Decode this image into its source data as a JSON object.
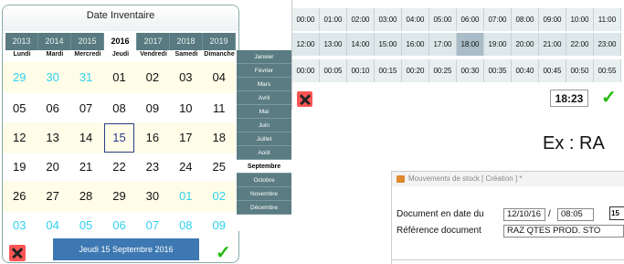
{
  "calendar": {
    "title": "Date Inventaire",
    "years": [
      "2013",
      "2014",
      "2015",
      "2016",
      "2017",
      "2018",
      "2019"
    ],
    "selected_year": "2016",
    "day_names": [
      "Lundi",
      "Mardi",
      "Mercredi",
      "Jeudi",
      "Vendredi",
      "Samedi",
      "Dimanche"
    ],
    "weeks": [
      [
        "29",
        "30",
        "31",
        "01",
        "02",
        "03",
        "04"
      ],
      [
        "05",
        "06",
        "07",
        "08",
        "09",
        "10",
        "11"
      ],
      [
        "12",
        "13",
        "14",
        "15",
        "16",
        "17",
        "18"
      ],
      [
        "19",
        "20",
        "21",
        "22",
        "23",
        "24",
        "25"
      ],
      [
        "26",
        "27",
        "28",
        "29",
        "30",
        "01",
        "02"
      ],
      [
        "03",
        "04",
        "05",
        "06",
        "07",
        "08",
        "09"
      ]
    ],
    "selected_day": "15",
    "months": [
      "Janvier",
      "Février",
      "Mars",
      "Avril",
      "Mai",
      "Juin",
      "Juillet",
      "Août",
      "Septembre",
      "Octobre",
      "Novembre",
      "Décembre"
    ],
    "selected_month": "Septembre",
    "selected_date_label": "Jeudi 15 Septembre 2016"
  },
  "time_picker": {
    "hours_row1": [
      "00:00",
      "01:00",
      "02:00",
      "03:00",
      "04:00",
      "05:00",
      "06:00",
      "07:00",
      "08:00",
      "09:00",
      "10:00",
      "11:00"
    ],
    "hours_row2": [
      "12:00",
      "13:00",
      "14:00",
      "15:00",
      "16:00",
      "17:00",
      "18:00",
      "19:00",
      "20:00",
      "21:00",
      "22:00",
      "23:00"
    ],
    "minutes": [
      "00:00",
      "00:05",
      "00:10",
      "00:15",
      "00:20",
      "00:25",
      "00:30",
      "00:35",
      "00:40",
      "00:45",
      "00:50",
      "00:55"
    ],
    "selected_hour": "18:00",
    "time_value": "18:23"
  },
  "example_text": "Ex : RA",
  "stock_window": {
    "title": "Mouvements de stock  [ Création ] *",
    "doc_date_label": "Document en date du",
    "doc_date": "12/10/16",
    "separator": "/",
    "doc_time": "08:05",
    "calendar_icon_text": "15",
    "ref_label": "Référence document",
    "ref_value": "RAZ QTES PROD. STO"
  },
  "colors": {
    "year_bar": "#587a80",
    "month_bar": "#5a7c82",
    "date_bar": "#3d78b2",
    "other_month_day": "#33d0f0",
    "close_button": "#ff5555",
    "ok_check": "#22bb11",
    "highlight_week": "#fffde8"
  }
}
